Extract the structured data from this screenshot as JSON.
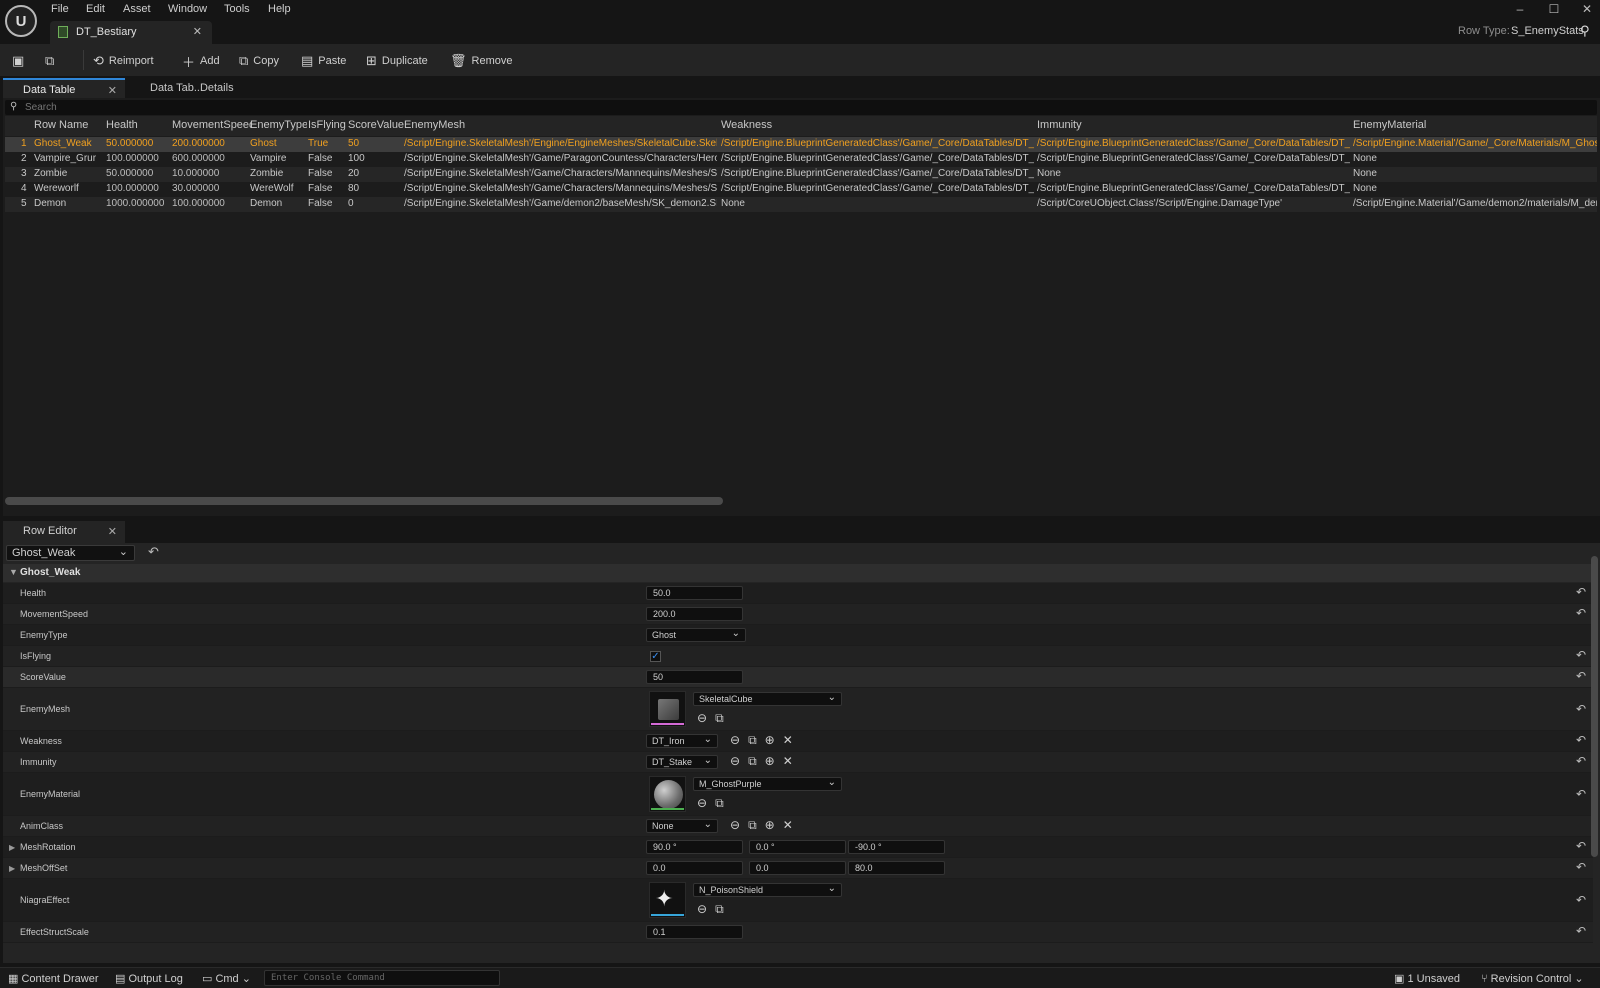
{
  "app": {
    "logo_text": "U",
    "menu": [
      "File",
      "Edit",
      "Asset",
      "Window",
      "Tools",
      "Help"
    ],
    "doc_tab": "DT_Bestiary",
    "row_type_label": "Row Type:",
    "row_type_value": "S_EnemyStats"
  },
  "toolbar": {
    "reimport": "Reimport",
    "add": "Add",
    "copy": "Copy",
    "paste": "Paste",
    "duplicate": "Duplicate",
    "remove": "Remove"
  },
  "tabs": {
    "data_table": "Data Table",
    "details": "Data Tab..Details",
    "row_editor": "Row Editor"
  },
  "search": {
    "placeholder": "Search"
  },
  "table": {
    "columns": [
      "Row Name",
      "Health",
      "MovementSpeed",
      "EnemyType",
      "IsFlying",
      "ScoreValue",
      "EnemyMesh",
      "Weakness",
      "Immunity",
      "EnemyMaterial"
    ],
    "rows": [
      [
        "1",
        "Ghost_Weak",
        "50.000000",
        "200.000000",
        "Ghost",
        "True",
        "50",
        "/Script/Engine.SkeletalMesh'/Engine/EngineMeshes/SkeletalCube.Skeleta",
        "/Script/Engine.BlueprintGeneratedClass'/Game/_Core/DataTables/DT_Iror",
        "/Script/Engine.BlueprintGeneratedClass'/Game/_Core/DataTables/DT_Sta",
        "/Script/Engine.Material'/Game/_Core/Materials/M_GhostP"
      ],
      [
        "2",
        "Vampire_Grur",
        "100.000000",
        "600.000000",
        "Vampire",
        "False",
        "100",
        "/Script/Engine.SkeletalMesh'/Game/ParagonCountess/Characters/Heroes",
        "/Script/Engine.BlueprintGeneratedClass'/Game/_Core/DataTables/DT_Sta",
        "/Script/Engine.BlueprintGeneratedClass'/Game/_Core/DataTables/DT_Iror",
        "None"
      ],
      [
        "3",
        "Zombie",
        "50.000000",
        "10.000000",
        "Zombie",
        "False",
        "20",
        "/Script/Engine.SkeletalMesh'/Game/Characters/Mannequins/Meshes/SKM",
        "/Script/Engine.BlueprintGeneratedClass'/Game/_Core/DataTables/DT_Fire",
        "None",
        "None"
      ],
      [
        "4",
        "Wereworlf",
        "100.000000",
        "30.000000",
        "WereWolf",
        "False",
        "80",
        "/Script/Engine.SkeletalMesh'/Game/Characters/Mannequins/Meshes/SKM",
        "/Script/Engine.BlueprintGeneratedClass'/Game/_Core/DataTables/DT_Silv",
        "/Script/Engine.BlueprintGeneratedClass'/Game/_Core/DataTables/DT_Sta",
        "None"
      ],
      [
        "5",
        "Demon",
        "1000.000000",
        "100.000000",
        "Demon",
        "False",
        "0",
        "/Script/Engine.SkeletalMesh'/Game/demon2/baseMesh/SK_demon2.SK_c",
        "None",
        "/Script/CoreUObject.Class'/Script/Engine.DamageType'",
        "/Script/Engine.Material'/Game/demon2/materials/M_demo"
      ]
    ]
  },
  "row_editor": {
    "selected_row": "Ghost_Weak",
    "section": "Ghost_Weak",
    "health_label": "Health",
    "health": "50.0",
    "speed_label": "MovementSpeed",
    "speed": "200.0",
    "type_label": "EnemyType",
    "type": "Ghost",
    "flying_label": "IsFlying",
    "score_label": "ScoreValue",
    "score": "50",
    "mesh_label": "EnemyMesh",
    "mesh": "SkeletalCube",
    "weakness_label": "Weakness",
    "weakness": "DT_Iron",
    "immunity_label": "Immunity",
    "immunity": "DT_Stake",
    "material_label": "EnemyMaterial",
    "material": "M_GhostPurple",
    "anim_label": "AnimClass",
    "anim": "None",
    "rotation_label": "MeshRotation",
    "rot_x": "90.0 °",
    "rot_y": "0.0 °",
    "rot_z": "-90.0 °",
    "offset_label": "MeshOffSet",
    "off_x": "0.0",
    "off_y": "0.0",
    "off_z": "80.0",
    "niagara_label": "NiagraEffect",
    "niagara": "N_PoisonShield",
    "scale_label": "EffectStructScale",
    "scale": "0.1"
  },
  "statusbar": {
    "content_drawer": "Content Drawer",
    "output_log": "Output Log",
    "cmd": "Cmd",
    "console_placeholder": "Enter Console Command",
    "unsaved": "1 Unsaved",
    "revision": "Revision Control"
  }
}
